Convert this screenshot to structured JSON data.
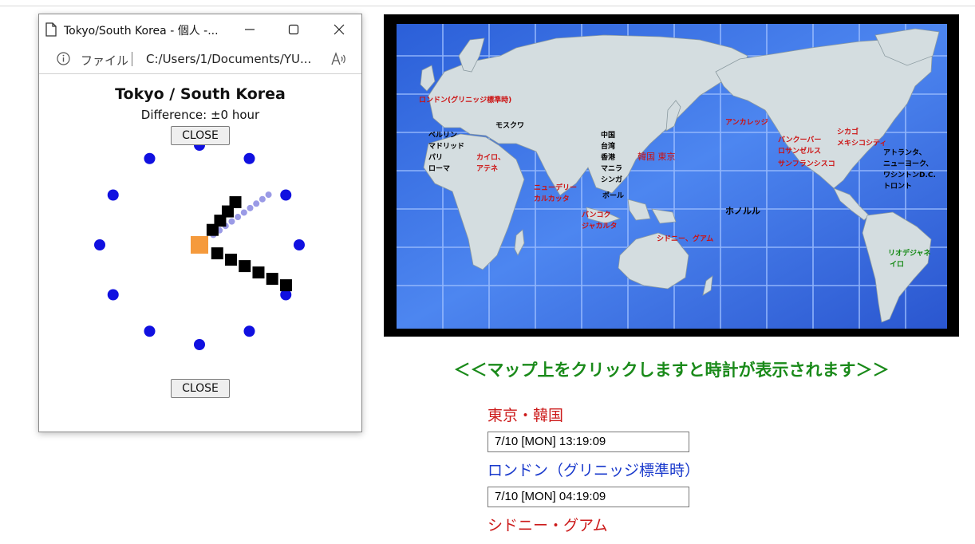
{
  "popup": {
    "window_title": "Tokyo/South Korea - 個人 -...",
    "address_label": "ファイル",
    "address_path": "C:/Users/1/Documents/YU...",
    "heading": "Tokyo / South Korea",
    "difference": "Difference: ±0 hour",
    "close_top": "CLOSE",
    "close_bottom": "CLOSE"
  },
  "clock": {
    "hour": 1,
    "minute": 19,
    "second": 9,
    "colors": {
      "dots": "#1010e0",
      "hands": "#000000",
      "second_hand": "#9a9ae6",
      "center": "#f59a3c"
    }
  },
  "map": {
    "labels": {
      "london": "ロンドン(グリニッジ標準時)",
      "moscow": "モスクワ",
      "berlin": "ベルリン",
      "madrid": "マドリッド",
      "paris": "パリ",
      "rome": "ローマ",
      "cairo": "カイロ、",
      "athens": "アテネ",
      "delhi": "ニューデリー",
      "calcutta": "カルカッタ",
      "china": "中国",
      "taiwan": "台湾",
      "hongkong": "香港",
      "manila": "マニラ",
      "singapore": "シンガ",
      "pore": "ポール",
      "bangkok": "バンコク",
      "jakarta": "ジャカルタ",
      "korea_tokyo": "韓国 東京",
      "sydney_guam": "シドニー、グアム",
      "honolulu": "ホノルル",
      "anchorage": "アンカレッジ",
      "vancouver": "バンクーバー",
      "la": "ロサンゼルス",
      "sf": "サンフランシスコ",
      "chicago": "シカゴ",
      "mexico": "メキシコシティ",
      "atlanta": "アトランタ、",
      "ny": "ニューヨーク、",
      "dc": "ワシントンD.C.",
      "toronto": "トロント",
      "rio1": "リオデジャネ",
      "rio2": "イロ"
    }
  },
  "notice": "＜＜マップ上をクリックしますと時計が表示されます＞＞",
  "cities": [
    {
      "name": "東京・韓国",
      "time": "7/10 [MON]  13:19:09"
    },
    {
      "name": "ロンドン（グリニッジ標準時）",
      "time": "7/10 [MON]  04:19:09"
    },
    {
      "name": "シドニー・グアム"
    }
  ]
}
